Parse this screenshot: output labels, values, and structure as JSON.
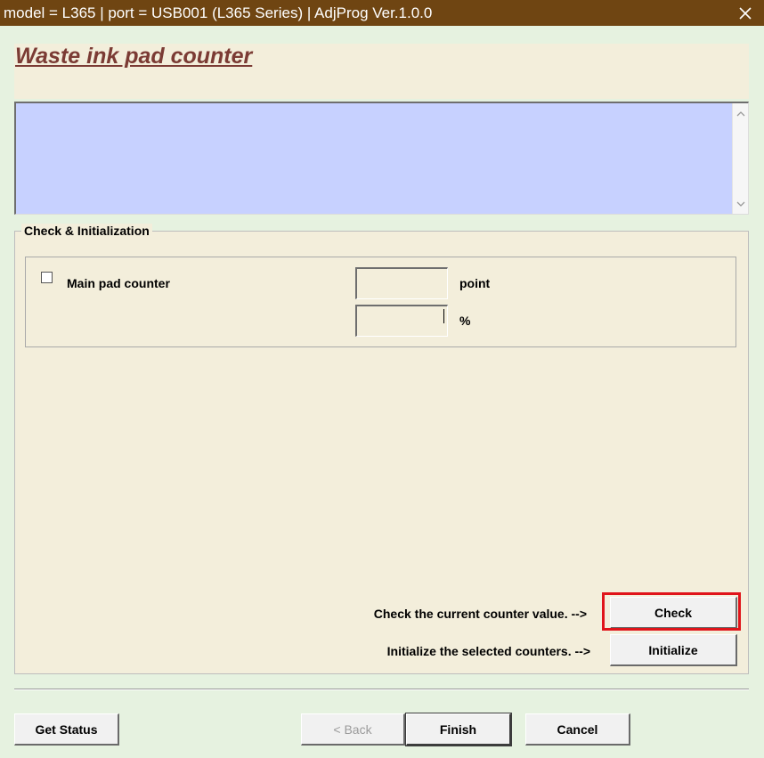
{
  "window": {
    "title": "model = L365 | port = USB001 (L365 Series) | AdjProg Ver.1.0.0"
  },
  "header": {
    "heading": "Waste ink pad counter"
  },
  "group": {
    "legend": "Check & Initialization",
    "main_pad": {
      "label": "Main pad counter",
      "checked": false,
      "point_value": "",
      "point_unit": "point",
      "percent_value": "",
      "percent_unit": "%"
    }
  },
  "actions": {
    "check_prompt": "Check the current counter value. -->",
    "check_label": "Check",
    "init_prompt": "Initialize the selected counters. -->",
    "init_label": "Initialize"
  },
  "footer": {
    "get_status": "Get Status",
    "back": "< Back",
    "finish": "Finish",
    "cancel": "Cancel"
  },
  "colors": {
    "titlebar": "#6f4512",
    "heading": "#7b3b34",
    "message_area": "#c7d1ff",
    "panel": "#f3eedb",
    "highlight": "#e0141a"
  }
}
